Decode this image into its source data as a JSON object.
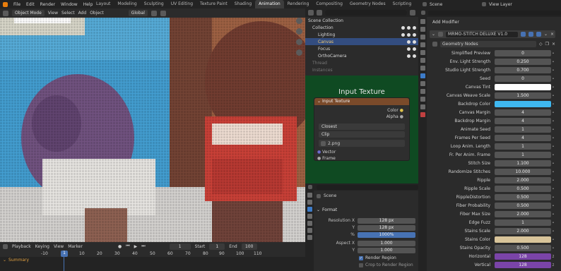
{
  "menubar": {
    "items": [
      "File",
      "Edit",
      "Render",
      "Window",
      "Help"
    ]
  },
  "workspaces": {
    "tabs": [
      "Layout",
      "Modeling",
      "Sculpting",
      "UV Editing",
      "Texture Paint",
      "Shading",
      "Animation",
      "Rendering",
      "Compositing",
      "Geometry Nodes",
      "Scripting"
    ],
    "active": "Animation"
  },
  "topright": {
    "scene": "Scene",
    "view_layer": "View Layer"
  },
  "viewport_header": {
    "mode": "Object Mode",
    "menus": [
      "View",
      "Select",
      "Add",
      "Object"
    ],
    "transform": "Global"
  },
  "outliner": {
    "items": [
      {
        "label": "Scene Collection",
        "level": 0
      },
      {
        "label": "Collection",
        "level": 1
      },
      {
        "label": "Lighting",
        "level": 2
      },
      {
        "label": "Canvas",
        "level": 2,
        "selected": true
      },
      {
        "label": "Focus",
        "level": 2
      },
      {
        "label": "OrthoCamera",
        "level": 2
      },
      {
        "label": "Thread",
        "level": 1,
        "dim": true
      },
      {
        "label": "Instances",
        "level": 1,
        "dim": true
      }
    ]
  },
  "node": {
    "title": "Input Texture",
    "header": "Input Texture",
    "out1": "Color",
    "out2": "Alpha",
    "interp": "Closest",
    "ext": "Clip",
    "image": "2.png",
    "in1": "Vector",
    "in2": "Frame"
  },
  "properties": {
    "scene": "Scene",
    "section": "Format",
    "fields": [
      {
        "label": "Resolution X",
        "value": "128 px"
      },
      {
        "label": "Y",
        "value": "128 px"
      },
      {
        "label": "%",
        "value": "1000%",
        "blue": true
      },
      {
        "label": "Aspect X",
        "value": "1.000"
      },
      {
        "label": "Y",
        "value": "1.000"
      }
    ],
    "render_region": "Render Region",
    "crop": "Crop to Render Region"
  },
  "timeline": {
    "playback": "Playback",
    "keying": "Keying",
    "view": "View",
    "marker": "Marker",
    "frame": "1",
    "start_label": "Start",
    "start": "1",
    "end_label": "End",
    "end": "100",
    "summary": "Summary",
    "ticks": [
      "-10",
      "0",
      "10",
      "20",
      "30",
      "40",
      "50",
      "60",
      "70",
      "80",
      "90",
      "100",
      "110"
    ]
  },
  "modifier": {
    "add": "Add Modifier",
    "name": "MRMO-STITCH DELUXE V1.0",
    "type": "Geometry Nodes",
    "fields": [
      {
        "label": "Simplified Preview",
        "value": "0"
      },
      {
        "label": "Env. Light Strength",
        "value": "0.250"
      },
      {
        "label": "Studio Light Strength",
        "value": "0.700"
      },
      {
        "label": "Seed",
        "value": "0"
      },
      {
        "label": "Canvas Tint",
        "value": "",
        "color": "#ffffff"
      },
      {
        "label": "Canvas Weave Scale",
        "value": "1.500"
      },
      {
        "label": "Backdrop Color",
        "value": "",
        "color": "#3fb8f0"
      },
      {
        "label": "Canvas Margin",
        "value": "4"
      },
      {
        "label": "Backdrop Margin",
        "value": "4"
      },
      {
        "label": "Animate Seed",
        "value": "1"
      },
      {
        "label": "Frames Per Seed",
        "value": "4"
      },
      {
        "label": "Loop Anim. Length",
        "value": "1"
      },
      {
        "label": "Fr. Per Anim. Frame",
        "value": "1"
      },
      {
        "label": "Stitch Size",
        "value": "1.100"
      },
      {
        "label": "Randomize Stitches",
        "value": "10.000"
      },
      {
        "label": "Ripple",
        "value": "2.000"
      },
      {
        "label": "Ripple Scale",
        "value": "0.500"
      },
      {
        "label": "RippleDistortion",
        "value": "0.500"
      },
      {
        "label": "Fiber Probability",
        "value": "0.500"
      },
      {
        "label": "Fiber Max Size",
        "value": "2.000"
      },
      {
        "label": "Edge Fuzz",
        "value": "1"
      },
      {
        "label": "Stains Scale",
        "value": "2.000"
      },
      {
        "label": "Stains Color",
        "value": "",
        "color": "#d8c49a"
      },
      {
        "label": "Stains Opacity",
        "value": "0.500"
      },
      {
        "label": "Horizontal",
        "value": "128",
        "purple": true,
        "suffix": "2"
      },
      {
        "label": "Vertical",
        "value": "128",
        "purple": true,
        "suffix": "2"
      }
    ]
  }
}
